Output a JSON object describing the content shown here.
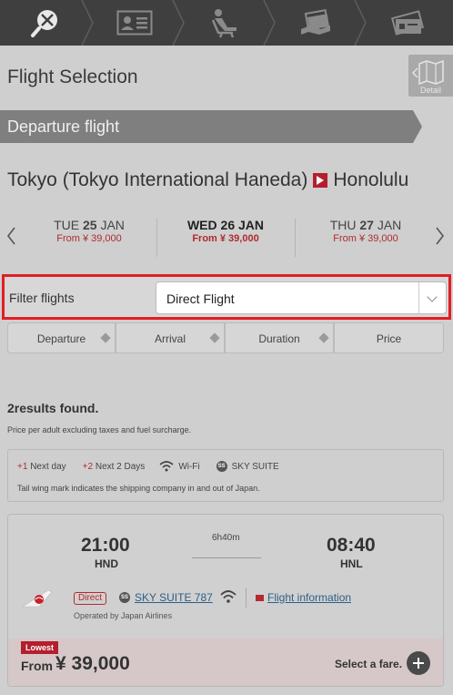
{
  "steps": [
    {
      "icon": "flight-search-icon",
      "active": true
    },
    {
      "icon": "passenger-card-icon",
      "active": false
    },
    {
      "icon": "seat-icon",
      "active": false
    },
    {
      "icon": "payment-icon",
      "active": false
    },
    {
      "icon": "ticket-icon",
      "active": false
    }
  ],
  "header": {
    "title": "Flight Selection",
    "detail_label": "Detail"
  },
  "departure_banner": "Departure flight",
  "route": {
    "origin": "Tokyo (Tokyo International Haneda)",
    "destination": "Honolulu"
  },
  "dates": [
    {
      "dow": "TUE",
      "day": "25",
      "month": "JAN",
      "price": "From ¥ 39,000",
      "selected": false
    },
    {
      "dow": "WED",
      "day": "26",
      "month": "JAN",
      "price": "From ¥ 39,000",
      "selected": true
    },
    {
      "dow": "THU",
      "day": "27",
      "month": "JAN",
      "price": "From ¥ 39,000",
      "selected": false
    }
  ],
  "filter": {
    "label": "Filter flights",
    "value": "Direct Flight"
  },
  "sort": [
    "Departure",
    "Arrival",
    "Duration",
    "Price"
  ],
  "results": {
    "count_text": "2results found.",
    "note": "Price per adult excluding taxes and fuel surcharge."
  },
  "legend": {
    "next_day_mark": "+1",
    "next_day": "Next day",
    "next_2_mark": "+2",
    "next_2": "Next 2 Days",
    "wifi": "Wi-Fi",
    "sky_suite": "SKY SUITE",
    "ss_badge": "SS",
    "tail_note": "Tail wing mark indicates the shipping company in and out of Japan."
  },
  "flight": {
    "dep_time": "21:00",
    "dep_code": "HND",
    "duration": "6h40m",
    "arr_time": "08:40",
    "arr_code": "HNL",
    "badge": "Direct",
    "ss_badge": "SS",
    "aircraft": "SKY SUITE 787",
    "flight_info": "Flight information",
    "operated_by": "Operated by Japan Airlines",
    "lowest_label": "Lowest",
    "from_label": "From",
    "price": "¥ 39,000",
    "select_fare": "Select a fare."
  },
  "colors": {
    "brand_red": "#b51e2d",
    "highlight_red": "#e21d24",
    "link_blue": "#2e5f86",
    "step_bar": "#3f3f3f"
  }
}
